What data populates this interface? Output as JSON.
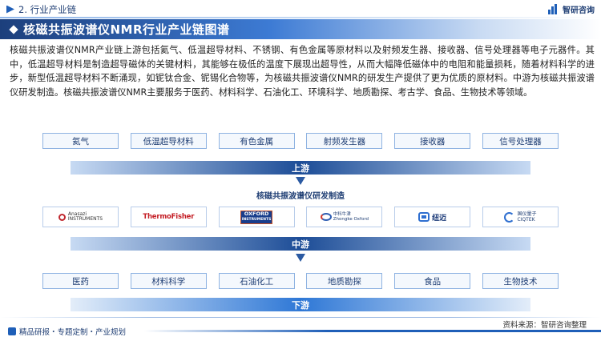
{
  "header": {
    "section": "2. 行业产业链",
    "brand": "智研咨询"
  },
  "title": "核磁共振波谱仪NMR行业产业链图谱",
  "intro": "核磁共振波谱仪NMR产业链上游包括氦气、低温超导材料、不锈钢、有色金属等原材料以及射频发生器、接收器、信号处理器等电子元器件。其中，低温超导材料是制造超导磁体的关键材料，其能够在极低的温度下展现出超导性，从而大幅降低磁体中的电阻和能量损耗，随着材料科学的进步，新型低温超导材料不断涌现，如铌钛合金、铌锡化合物等，为核磁共振波谱仪NMR的研发生产提供了更为优质的原材料。中游为核磁共振波谱仪研发制造。核磁共振波谱仪NMR主要服务于医药、材料科学、石油化工、环境科学、地质勘探、考古学、食品、生物技术等领域。",
  "upstream": {
    "items": [
      "氦气",
      "低温超导材料",
      "有色金属",
      "射频发生器",
      "接收器",
      "信号处理器"
    ],
    "label": "上游"
  },
  "midstream": {
    "title": "核磁共振波谱仪研发制造",
    "label": "中游",
    "logos": [
      {
        "icon": "anasazi-logo",
        "text": [
          "Anasazi",
          "INSTRUMENTS"
        ]
      },
      {
        "icon": "thermofisher-logo",
        "text": [
          "ThermoFisher",
          "SCIENTIFIC"
        ]
      },
      {
        "icon": "oxford-instruments-logo",
        "text": [
          "OXFORD",
          "INSTRUMENTS"
        ]
      },
      {
        "icon": "zhongke-niuyi-logo",
        "text": [
          "中科牛津",
          "Zhongke Oxford"
        ]
      },
      {
        "icon": "niumag-logo",
        "text": [
          "纽迈"
        ]
      },
      {
        "icon": "ciqtek-logo",
        "text": [
          "国仪量子",
          "CIQTEK"
        ]
      }
    ]
  },
  "downstream": {
    "items": [
      "医药",
      "材料科学",
      "石油化工",
      "地质勘探",
      "食品",
      "生物技术"
    ],
    "label": "下游"
  },
  "footer": {
    "source": "资料来源：智研咨询整理",
    "slogan": "精品研报・专题定制・产业规划"
  },
  "colors": {
    "primary": "#1f3e74",
    "accent": "#1f5fb8",
    "band": "#1d4d97",
    "box_border": "#8fb3e2"
  }
}
